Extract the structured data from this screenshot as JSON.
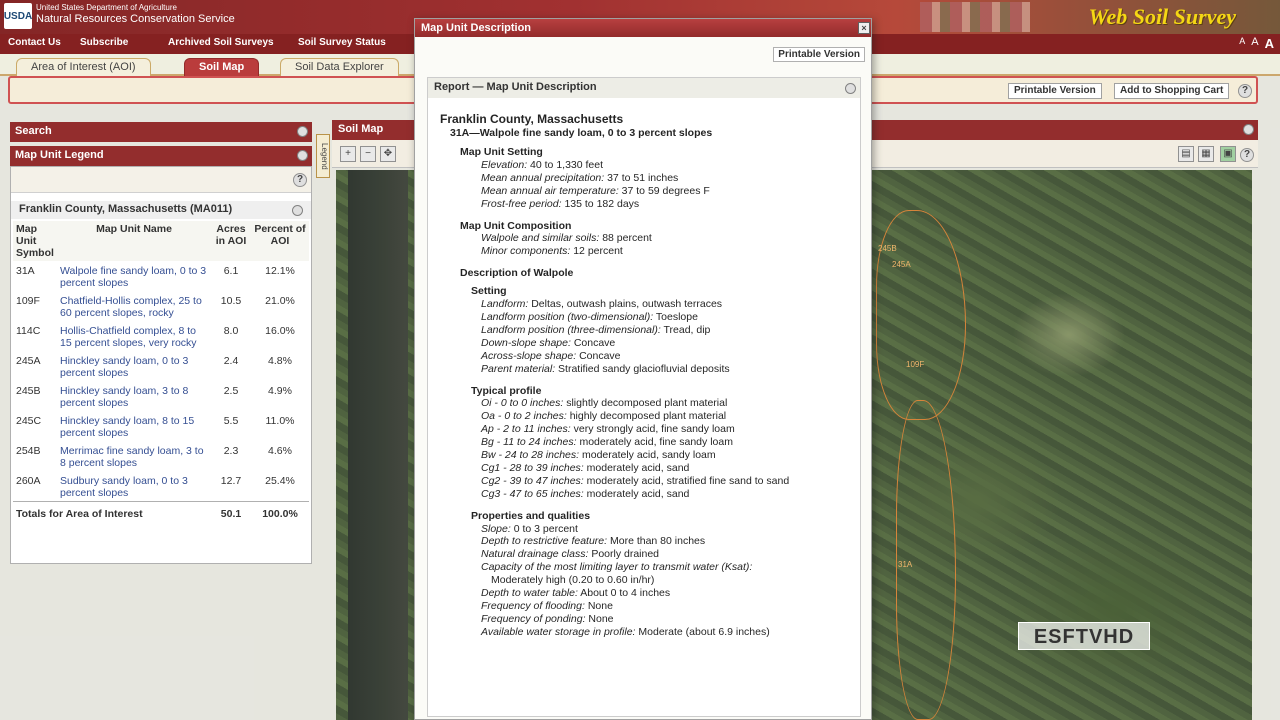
{
  "banner": {
    "usda": "USDA",
    "agency_line1": "United States Department of Agriculture",
    "agency_line2": "Natural Resources Conservation Service",
    "app_title": "Web Soil Survey"
  },
  "nav": {
    "contact": "Contact Us",
    "subscribe": "Subscribe",
    "archived": "Archived Soil Surveys",
    "status": "Soil Survey Status",
    "font_controls": [
      "A",
      "A",
      "A"
    ]
  },
  "tabs": [
    "Area of Interest (AOI)",
    "Soil Map",
    "Soil Data Explorer"
  ],
  "toolbar": {
    "printable": "Printable Version",
    "cart": "Add to Shopping Cart",
    "help": "?"
  },
  "left": {
    "search_title": "Search",
    "legend_title": "Map Unit Legend",
    "legend_tab": "Legend",
    "help": "?",
    "aoi_title": "Franklin County, Massachusetts (MA011)",
    "columns": [
      "Map Unit Symbol",
      "Map Unit Name",
      "Acres in AOI",
      "Percent of AOI"
    ],
    "rows": [
      {
        "symbol": "31A",
        "name": "Walpole fine sandy loam, 0 to 3 percent slopes",
        "acres": "6.1",
        "percent": "12.1%"
      },
      {
        "symbol": "109F",
        "name": "Chatfield-Hollis complex, 25 to 60 percent slopes, rocky",
        "acres": "10.5",
        "percent": "21.0%"
      },
      {
        "symbol": "114C",
        "name": "Hollis-Chatfield complex, 8 to 15 percent slopes, very rocky",
        "acres": "8.0",
        "percent": "16.0%"
      },
      {
        "symbol": "245A",
        "name": "Hinckley sandy loam, 0 to 3 percent slopes",
        "acres": "2.4",
        "percent": "4.8%"
      },
      {
        "symbol": "245B",
        "name": "Hinckley sandy loam, 3 to 8 percent slopes",
        "acres": "2.5",
        "percent": "4.9%"
      },
      {
        "symbol": "245C",
        "name": "Hinckley sandy loam, 8 to 15 percent slopes",
        "acres": "5.5",
        "percent": "11.0%"
      },
      {
        "symbol": "254B",
        "name": "Merrimac fine sandy loam, 3 to 8 percent slopes",
        "acres": "2.3",
        "percent": "4.6%"
      },
      {
        "symbol": "260A",
        "name": "Sudbury sandy loam, 0 to 3 percent slopes",
        "acres": "12.7",
        "percent": "25.4%"
      }
    ],
    "total_label": "Totals for Area of Interest",
    "total_acres": "50.1",
    "total_percent": "100.0%"
  },
  "map": {
    "title": "Soil Map",
    "soil_labels": [
      "245B",
      "245A",
      "31A",
      "109F"
    ]
  },
  "modal": {
    "title": "Map Unit Description",
    "printable": "Printable Version",
    "report_head": "Report — Map Unit Description",
    "county": "Franklin County, Massachusetts",
    "unit": "31A—Walpole fine sandy loam, 0 to 3 percent slopes",
    "setting_h": "Map Unit Setting",
    "setting": [
      {
        "k": "Elevation:",
        "v": "40 to 1,330 feet"
      },
      {
        "k": "Mean annual precipitation:",
        "v": "37 to 51 inches"
      },
      {
        "k": "Mean annual air temperature:",
        "v": "37 to 59 degrees F"
      },
      {
        "k": "Frost-free period:",
        "v": "135 to 182 days"
      }
    ],
    "composition_h": "Map Unit Composition",
    "composition": [
      {
        "k": "Walpole and similar soils:",
        "v": "88 percent"
      },
      {
        "k": "Minor components:",
        "v": "12 percent"
      }
    ],
    "desc_h": "Description of Walpole",
    "setting2_h": "Setting",
    "setting2": [
      {
        "k": "Landform:",
        "v": "Deltas, outwash plains, outwash terraces"
      },
      {
        "k": "Landform position (two-dimensional):",
        "v": "Toeslope"
      },
      {
        "k": "Landform position (three-dimensional):",
        "v": "Tread, dip"
      },
      {
        "k": "Down-slope shape:",
        "v": "Concave"
      },
      {
        "k": "Across-slope shape:",
        "v": "Concave"
      },
      {
        "k": "Parent material:",
        "v": "Stratified sandy glaciofluvial deposits"
      }
    ],
    "profile_h": "Typical profile",
    "profile": [
      {
        "k": "Oi - 0 to 0 inches:",
        "v": "slightly decomposed plant material"
      },
      {
        "k": "Oa - 0 to 2 inches:",
        "v": "highly decomposed plant material"
      },
      {
        "k": "Ap - 2 to 11 inches:",
        "v": "very strongly acid, fine sandy loam"
      },
      {
        "k": "Bg - 11 to 24 inches:",
        "v": "moderately acid, fine sandy loam"
      },
      {
        "k": "Bw - 24 to 28 inches:",
        "v": "moderately acid, sandy loam"
      },
      {
        "k": "Cg1 - 28 to 39 inches:",
        "v": "moderately acid, sand"
      },
      {
        "k": "Cg2 - 39 to 47 inches:",
        "v": "moderately acid, stratified fine sand to sand"
      },
      {
        "k": "Cg3 - 47 to 65 inches:",
        "v": "moderately acid, sand"
      }
    ],
    "props_h": "Properties and qualities",
    "props": [
      {
        "k": "Slope:",
        "v": "0 to 3 percent"
      },
      {
        "k": "Depth to restrictive feature:",
        "v": "More than 80 inches"
      },
      {
        "k": "Natural drainage class:",
        "v": "Poorly drained"
      },
      {
        "k": "Capacity of the most limiting layer to transmit water (Ksat):",
        "v": ""
      }
    ],
    "ksat_value": "Moderately high (0.20 to 0.60 in/hr)",
    "props2": [
      {
        "k": "Depth to water table:",
        "v": "About 0 to 4 inches"
      },
      {
        "k": "Frequency of flooding:",
        "v": "None"
      },
      {
        "k": "Frequency of ponding:",
        "v": "None"
      },
      {
        "k": "Available water storage in profile:",
        "v": "Moderate (about 6.9 inches)"
      }
    ]
  },
  "watermark": "ESFTVHD"
}
